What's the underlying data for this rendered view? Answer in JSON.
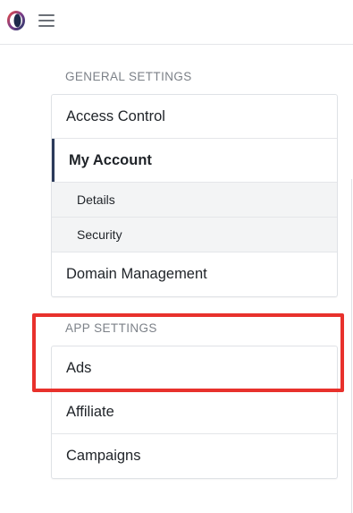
{
  "header": {
    "logo_icon": "o-ring-logo-icon",
    "menu_icon": "hamburger-menu-icon"
  },
  "general_settings": {
    "heading": "GENERAL SETTINGS",
    "items": [
      {
        "label": "Access Control",
        "active": false
      },
      {
        "label": "My Account",
        "active": true,
        "subitems": [
          {
            "label": "Details"
          },
          {
            "label": "Security"
          }
        ]
      },
      {
        "label": "Domain Management",
        "active": false
      }
    ]
  },
  "app_settings": {
    "heading": "APP SETTINGS",
    "items": [
      {
        "label": "Ads"
      },
      {
        "label": "Affiliate"
      },
      {
        "label": "Campaigns"
      }
    ]
  },
  "colors": {
    "annotation_red": "#e8312c",
    "active_indicator": "#2b3a5a"
  }
}
